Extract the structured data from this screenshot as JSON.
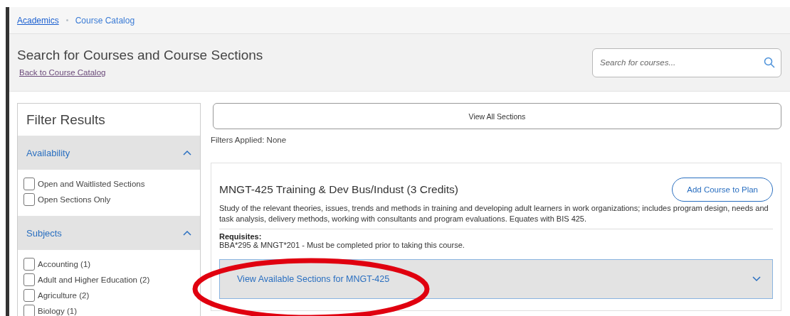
{
  "breadcrumb": [
    {
      "label": "Academics",
      "kind": "link"
    },
    {
      "label": "Course Catalog",
      "kind": "current"
    }
  ],
  "header": {
    "title": "Search for Courses and Course Sections",
    "back_link": "Back to Course Catalog",
    "search": {
      "placeholder": "Search for courses..."
    }
  },
  "filter": {
    "title": "Filter Results",
    "groups": [
      {
        "title": "Availability",
        "expanded": true,
        "options": [
          {
            "label": "Open and Waitlisted Sections",
            "checked": false
          },
          {
            "label": "Open Sections Only",
            "checked": false
          }
        ]
      },
      {
        "title": "Subjects",
        "expanded": true,
        "options": [
          {
            "label": "Accounting (1)",
            "checked": false
          },
          {
            "label": "Adult and Higher Education (2)",
            "checked": false
          },
          {
            "label": "Agriculture (2)",
            "checked": false
          },
          {
            "label": "Biology (1)",
            "checked": false
          }
        ]
      }
    ]
  },
  "view_all_button": "View All Sections",
  "filters_applied": "Filters Applied: None",
  "course": {
    "title": "MNGT-425 Training & Dev Bus/Indust (3 Credits)",
    "add_button": "Add Course to Plan",
    "description": "Study of the relevant theories, issues, trends and methods in training and developing adult learners in work organizations; includes program design, needs and task analysis, delivery methods, working with consultants and program evaluations. Equates with BIS 425.",
    "requisites_label": "Requisites:",
    "requisites": "BBA*295 & MNGT*201 - Must be completed prior to taking this course.",
    "sections_toggle": {
      "label": "View Available Sections for MNGT-425",
      "expanded": false
    }
  }
}
